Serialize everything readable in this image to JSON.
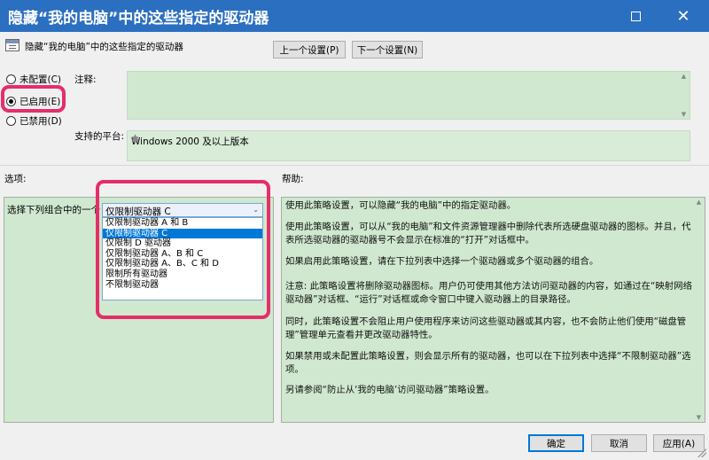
{
  "window": {
    "title": "隐藏“我的电脑”中的这些指定的驱动器",
    "maximize_icon": "maximize-icon",
    "close_icon": "close-icon",
    "close_glyph": "✕"
  },
  "header": {
    "policy_name": "隐藏“我的电脑”中的这些指定的驱动器",
    "prev_label": "上一个设置(P)",
    "next_label": "下一个设置(N)"
  },
  "radios": {
    "not_configured": "未配置(C)",
    "enabled": "已启用(E)",
    "disabled": "已禁用(D)",
    "selected": "enabled"
  },
  "comment": {
    "label": "注释:",
    "value": ""
  },
  "platform": {
    "label": "支持的平台:",
    "value": "Windows 2000 及以上版本"
  },
  "options": {
    "label": "选项:",
    "combo_label": "选择下列组合中的一个",
    "selected_value": "仅限制驱动器 C",
    "items": [
      "仅限制驱动器 A 和 B",
      "仅限制驱动器 C",
      "仅限制 D 驱动器",
      "仅限制驱动器 A、B 和 C",
      "仅限制驱动器 A、B、C 和 D",
      "限制所有驱动器",
      "不限制驱动器"
    ],
    "selected_index": 1
  },
  "help": {
    "label": "帮助:",
    "paragraphs": [
      "使用此策略设置，可以隐藏“我的电脑”中的指定驱动器。",
      "使用此策略设置，可以从“我的电脑”和文件资源管理器中删除代表所选硬盘驱动器的图标。并且，代表所选驱动器的驱动器号不会显示在标准的“打开”对话框中。",
      "如果启用此策略设置，请在下拉列表中选择一个驱动器或多个驱动器的组合。",
      "注意: 此策略设置将删除驱动器图标。用户仍可使用其他方法访问驱动器的内容，如通过在“映射网络驱动器”对话框、“运行”对话框或命令窗口中键入驱动器上的目录路径。",
      "同时，此策略设置不会阻止用户使用程序来访问这些驱动器或其内容，也不会防止他们使用“磁盘管理”管理单元查看并更改驱动器特性。",
      "如果禁用或未配置此策略设置，则会显示所有的驱动器，也可以在下拉列表中选择“不限制驱动器”选项。",
      "另请参阅“防止从‘我的电脑’访问驱动器”策略设置。"
    ]
  },
  "footer": {
    "ok_label": "确定",
    "cancel_label": "取消",
    "apply_label": "应用(A)"
  },
  "colors": {
    "titlebar": "#2b6fc0",
    "field_green": "#cfe8cf",
    "highlight": "#e52e6a",
    "selection": "#0078d7"
  }
}
